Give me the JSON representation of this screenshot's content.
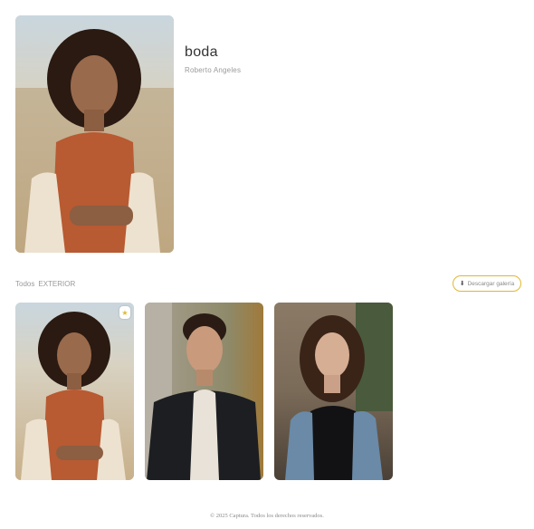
{
  "gallery": {
    "title": "boda",
    "subtitle": "Roberto Angeles"
  },
  "tabs": [
    {
      "label": "Todos"
    },
    {
      "label": "EXTERIOR"
    }
  ],
  "download": {
    "icon": "download-icon",
    "label": "Descargar galería"
  },
  "photos": [
    {
      "name": "woman-orange-dress",
      "favorite": true,
      "icon": "star-icon"
    },
    {
      "name": "man-dark-blazer",
      "favorite": false
    },
    {
      "name": "woman-denim-jacket",
      "favorite": false
    }
  ],
  "footer": {
    "text": "© 2025 Captura. Todos los derechos reservados."
  },
  "colors": {
    "accent": "#e0b832"
  }
}
